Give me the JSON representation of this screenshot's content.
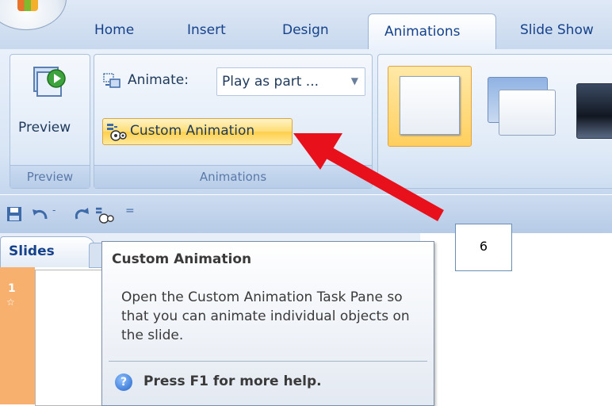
{
  "tabs": [
    {
      "label": "Home"
    },
    {
      "label": "Insert"
    },
    {
      "label": "Design"
    },
    {
      "label": "Animations"
    },
    {
      "label": "Slide Show"
    }
  ],
  "preview_group": {
    "button_label": "Preview",
    "group_label": "Preview"
  },
  "animations_group": {
    "animate_label": "Animate:",
    "animate_value": "Play as part ...",
    "custom_animation_label": "Custom Animation",
    "group_label": "Animations"
  },
  "slides_pane": {
    "tab_label": "Slides",
    "slide_number": "1"
  },
  "tooltip": {
    "title": "Custom Animation",
    "body": "Open the Custom Animation Task Pane so that you can animate individual objects on the slide.",
    "help": "Press F1 for more help."
  },
  "callout": {
    "label": "6"
  },
  "colors": {
    "arrow": "#e8101a",
    "accent": "#15428b",
    "highlight": "#ffd35c"
  }
}
